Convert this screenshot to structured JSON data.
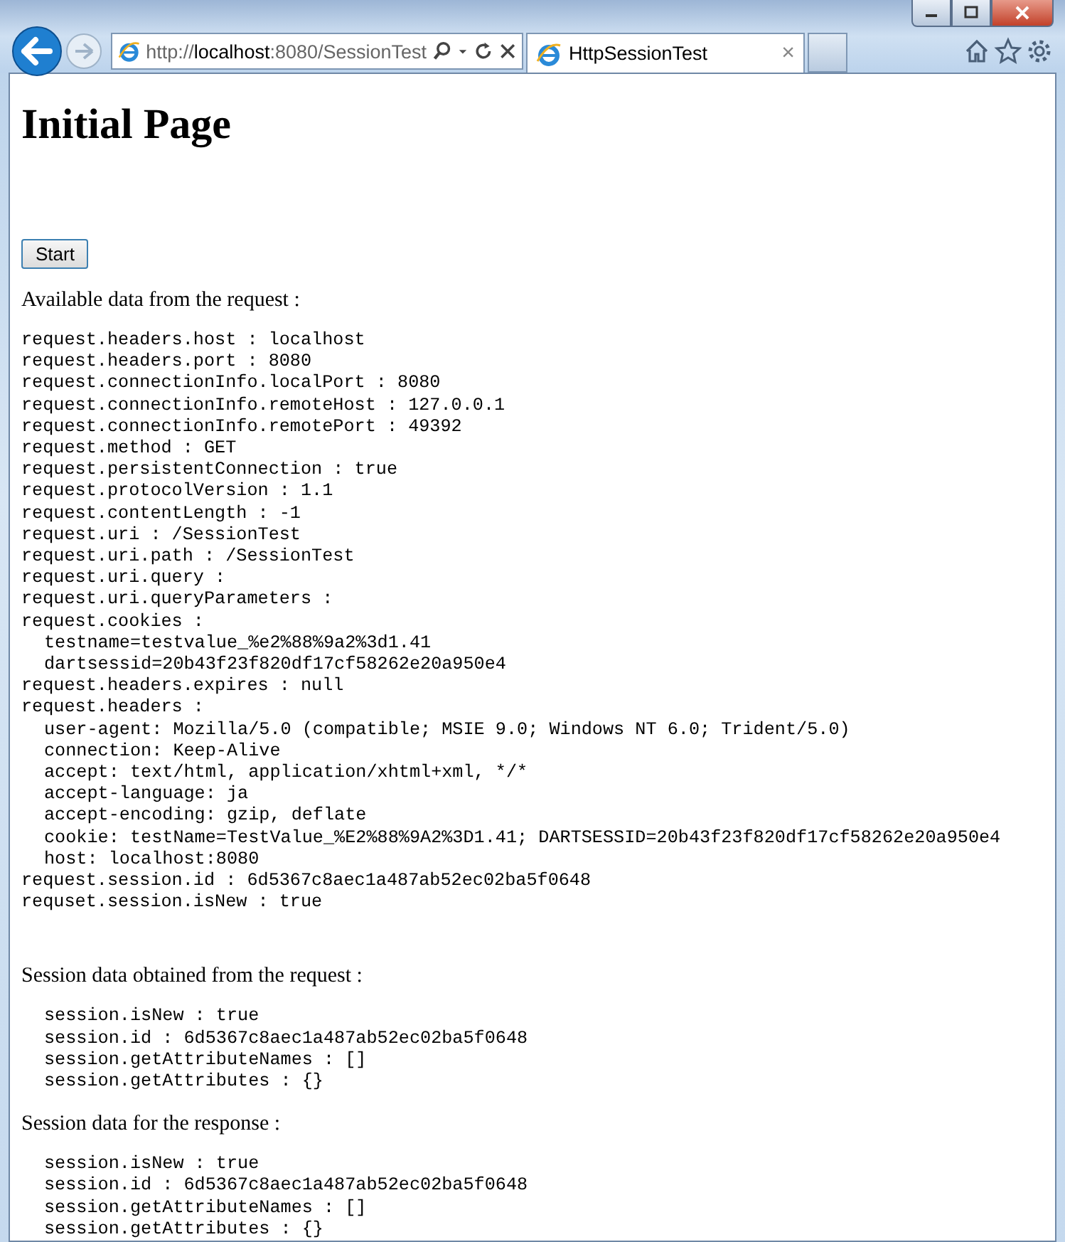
{
  "browser": {
    "address": "http://**localhost**:8080/SessionTest",
    "tabs": [
      {
        "title": "HttpSessionTest",
        "close": "×",
        "selected": true
      }
    ]
  },
  "page": {
    "heading": "Initial Page",
    "button": "Start",
    "sections": [
      {
        "heading": "Available data from the request :",
        "kind": "flat",
        "lines": [
          {
            "text": "request.headers.host : localhost"
          },
          {
            "text": "request.headers.port : 8080"
          },
          {
            "text": "request.connectionInfo.localPort : 8080"
          },
          {
            "text": "request.connectionInfo.remoteHost : 127.0.0.1"
          },
          {
            "text": "request.connectionInfo.remotePort : 49392"
          },
          {
            "text": "request.method : GET"
          },
          {
            "text": "request.persistentConnection : true"
          },
          {
            "text": "request.protocolVersion : 1.1"
          },
          {
            "text": "request.contentLength : -1"
          },
          {
            "text": "request.uri : /SessionTest"
          },
          {
            "text": "request.uri.path : /SessionTest"
          },
          {
            "text": "request.uri.query :"
          },
          {
            "text": "request.uri.queryParameters :"
          },
          {
            "text": "request.cookies :",
            "children": [
              {
                "text": "testname=testvalue_%e2%88%9a2%3d1.41"
              },
              {
                "text": "dartsessid=20b43f23f820df17cf58262e20a950e4"
              }
            ]
          },
          {
            "text": "request.headers.expires : null"
          },
          {
            "text": "request.headers :",
            "children": [
              {
                "text": "user-agent: Mozilla/5.0 (compatible; MSIE 9.0; Windows NT 6.0; Trident/5.0)"
              },
              {
                "text": "connection: Keep-Alive"
              },
              {
                "text": "accept: text/html, application/xhtml+xml, */*"
              },
              {
                "text": "accept-language: ja"
              },
              {
                "text": "accept-encoding: gzip, deflate"
              },
              {
                "text": "cookie: testName=TestValue_%E2%88%9A2%3D1.41; DARTSESSID=20b43f23f820df17cf58262e20a950e4"
              },
              {
                "text": "host: localhost:8080"
              }
            ]
          },
          {
            "text": "request.session.id : 6d5367c8aec1a487ab52ec02ba5f0648"
          },
          {
            "text": "requset.session.isNew : true"
          }
        ]
      },
      {
        "heading": "Session data obtained from the request :",
        "kind": "indented",
        "lines": [
          {
            "text": "session.isNew : true"
          },
          {
            "text": "session.id : 6d5367c8aec1a487ab52ec02ba5f0648"
          },
          {
            "text": "session.getAttributeNames : []"
          },
          {
            "text": "session.getAttributes : {}"
          }
        ]
      },
      {
        "heading": "Session data for the response :",
        "kind": "indented",
        "lines": [
          {
            "text": "session.isNew : true"
          },
          {
            "text": "session.id : 6d5367c8aec1a487ab52ec02ba5f0648"
          },
          {
            "text": "session.getAttributeNames : []"
          },
          {
            "text": "session.getAttributes : {}"
          }
        ]
      }
    ]
  }
}
